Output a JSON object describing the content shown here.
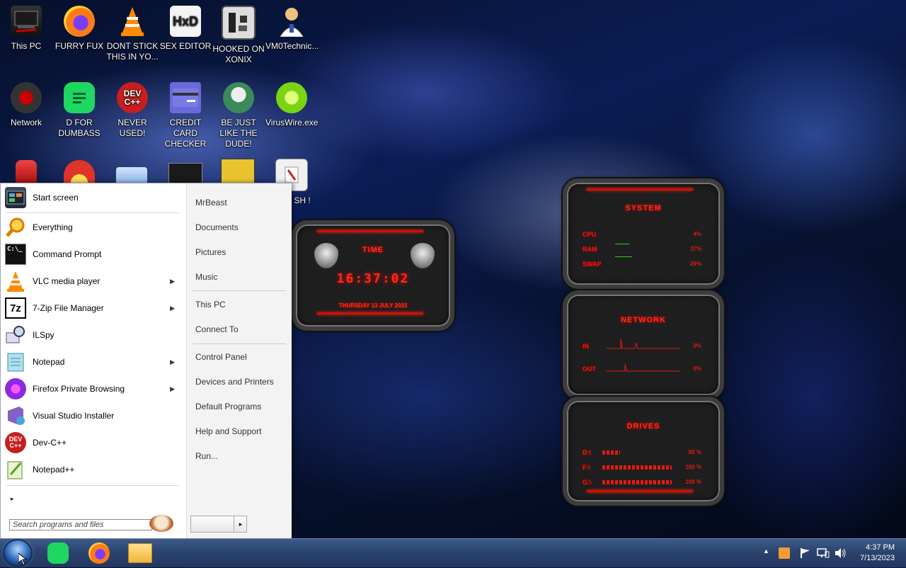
{
  "desktop": {
    "icons": [
      {
        "label": "This PC",
        "icon": "computer-icon"
      },
      {
        "label": "FURRY FUX",
        "icon": "firefox-icon"
      },
      {
        "label": "DONT STICK THIS IN YO...",
        "icon": "vlc-cone-icon"
      },
      {
        "label": "SEX EDITOR",
        "icon": "hex-editor-icon"
      },
      {
        "label": "HOOKED ON XONIX",
        "icon": "game-icon"
      },
      {
        "label": "VM0Technic...",
        "icon": "doctor-icon"
      },
      {
        "label": "Network",
        "icon": "network-icon"
      },
      {
        "label": "D FOR DUMBASS",
        "icon": "chat-icon"
      },
      {
        "label": "NEVER USED!",
        "icon": "devcpp-icon",
        "text": "DEV\nC++"
      },
      {
        "label": "CREDIT CARD CHECKER",
        "icon": "card-icon"
      },
      {
        "label": "BE JUST LIKE THE DUDE!",
        "icon": "santa-icon"
      },
      {
        "label": "VirusWire.exe",
        "icon": "limewire-icon"
      },
      {
        "label": "SH !",
        "icon": "app-icon"
      }
    ]
  },
  "start_menu": {
    "programs": [
      {
        "label": "Start screen",
        "icon": "start-screen-icon",
        "submenu": false
      },
      {
        "label": "Everything",
        "icon": "magnifier-icon",
        "submenu": false
      },
      {
        "label": "Command Prompt",
        "icon": "cmd-icon",
        "submenu": false,
        "icon_text": "C:\\_"
      },
      {
        "label": "VLC media player",
        "icon": "vlc-icon",
        "submenu": true
      },
      {
        "label": "7-Zip File Manager",
        "icon": "7zip-icon",
        "submenu": true,
        "icon_text": "7z"
      },
      {
        "label": "ILSpy",
        "icon": "ilspy-icon",
        "submenu": false
      },
      {
        "label": "Notepad",
        "icon": "notepad-icon",
        "submenu": true
      },
      {
        "label": "Firefox Private Browsing",
        "icon": "firefox-private-icon",
        "submenu": true
      },
      {
        "label": "Visual Studio Installer",
        "icon": "vs-installer-icon",
        "submenu": false
      },
      {
        "label": "Dev-C++",
        "icon": "devcpp-icon",
        "submenu": false,
        "icon_text": "DEV\nC++"
      },
      {
        "label": "Notepad++",
        "icon": "notepadpp-icon",
        "submenu": false
      }
    ],
    "right_items": [
      {
        "label": "MrBeast"
      },
      {
        "label": "Documents"
      },
      {
        "label": "Pictures"
      },
      {
        "label": "Music"
      },
      {
        "label": "This PC"
      },
      {
        "label": "Connect To"
      },
      {
        "label": "Control Panel"
      },
      {
        "label": "Devices and Printers"
      },
      {
        "label": "Default Programs"
      },
      {
        "label": "Help and Support"
      },
      {
        "label": "Run..."
      }
    ],
    "search_placeholder": "Search programs and files",
    "all_programs_arrow": "▸",
    "shutdown_arrow": "▸"
  },
  "gadgets": {
    "time": {
      "title": "TIME",
      "clock": "16:37:02",
      "date": "THURSDAY 13 JULY 2023"
    },
    "system": {
      "title": "SYSTEM",
      "rows": [
        {
          "label": "CPU",
          "value": "4%"
        },
        {
          "label": "RAM",
          "value": "37%"
        },
        {
          "label": "SWAP",
          "value": "29%"
        }
      ]
    },
    "network": {
      "title": "NETWORK",
      "rows": [
        {
          "label": "IN",
          "value": "0%"
        },
        {
          "label": "OUT",
          "value": "0%"
        }
      ]
    },
    "drives": {
      "title": "DRIVES",
      "rows": [
        {
          "label": "D:\\",
          "value": "85 %",
          "fill": 0.25
        },
        {
          "label": "F:\\",
          "value": "100 %",
          "fill": 1.0
        },
        {
          "label": "G:\\",
          "value": "100 %",
          "fill": 1.0
        }
      ]
    }
  },
  "taskbar": {
    "pinned": [
      {
        "icon": "chat-icon"
      },
      {
        "icon": "firefox-icon"
      },
      {
        "icon": "file-explorer-icon"
      }
    ],
    "tray": {
      "arrow": "▲",
      "time": "4:37 PM",
      "date": "7/13/2023"
    }
  },
  "colors": {
    "accent_red": "#e31a10",
    "taskbar_blue": "#2b446e"
  }
}
